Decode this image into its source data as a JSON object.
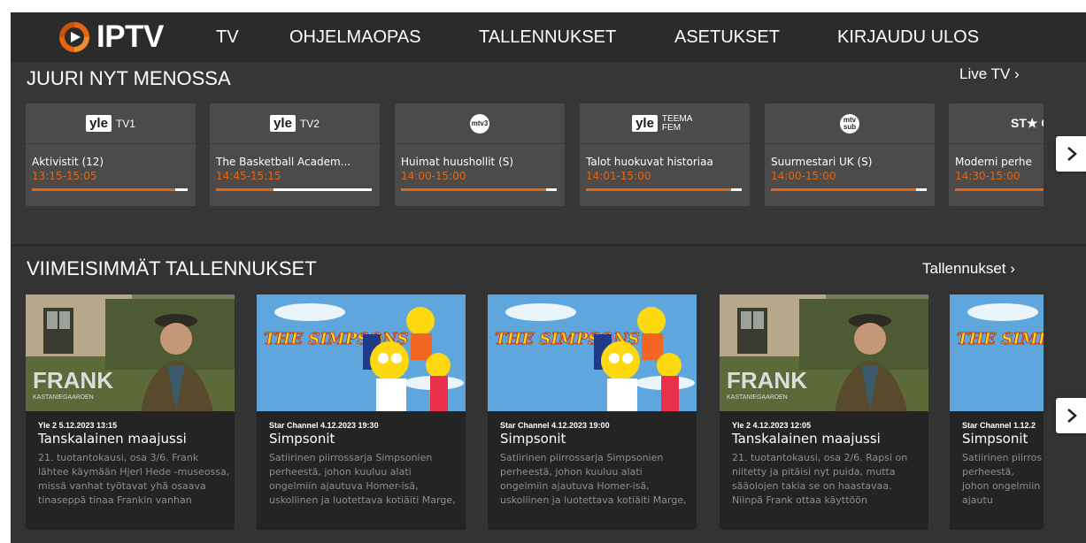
{
  "header": {
    "logo_text": "IPTV",
    "nav": [
      "TV",
      "OHJELMAOPAS",
      "TALLENNUKSET",
      "ASETUKSET",
      "KIRJAUDU ULOS"
    ]
  },
  "now_playing": {
    "title": "JUURI NYT MENOSSA",
    "link": "Live TV ›",
    "channels": [
      {
        "logo": "yle",
        "logo_sub": "TV1",
        "program": "Aktivistit (12)",
        "time": "13:15-15:05",
        "progress": 0.92
      },
      {
        "logo": "yle",
        "logo_sub": "TV2",
        "program": "The Basketball Academ...",
        "time": "14:45-15:15",
        "progress": 0.37
      },
      {
        "logo": "mtv3",
        "logo_sub": "mtv3",
        "program": "Huimat huushollit (S)",
        "time": "14:00-15:00",
        "progress": 0.93
      },
      {
        "logo": "yle",
        "logo_sub": "TEEMA FEM",
        "program": "Talot huokuvat historiaa",
        "time": "14:01-15:00",
        "progress": 0.93
      },
      {
        "logo": "mtv",
        "logo_sub": "mtv sub",
        "program": "Suurmestari UK (S)",
        "time": "14:00-15:00",
        "progress": 0.93
      },
      {
        "logo": "star",
        "logo_sub": "ST★ CHANN",
        "program": "Moderni perhe",
        "time": "14:30-15:00",
        "progress": 0.8
      }
    ]
  },
  "recordings": {
    "title": "VIIMEISIMMÄT TALLENNUKSET",
    "link": "Tallennukset ›",
    "items": [
      {
        "thumb": "frank",
        "meta": "Yle 2 5.12.2023  13:15",
        "title": "Tanskalainen maajussi",
        "desc": "21. tuotantokausi, osa 3/6. Frank lähtee käymään Hjerl Hede -museossa, missä vanhat työtavat yhä osaava tinaseppä tinaa Frankin vanhan"
      },
      {
        "thumb": "simpsons",
        "meta": "Star Channel 4.12.2023  19:30",
        "title": "Simpsonit",
        "desc": "Satiirinen piirrossarja Simpsonien perheestä, johon kuuluu alati ongelmiin ajautuva Homer-isä, uskollinen ja luotettava kotiäiti Marge,"
      },
      {
        "thumb": "simpsons",
        "meta": "Star Channel 4.12.2023  19:00",
        "title": "Simpsonit",
        "desc": "Satiirinen piirrossarja Simpsonien perheestä, johon kuuluu alati ongelmiin ajautuva Homer-isä, uskollinen ja luotettava kotiäiti Marge,"
      },
      {
        "thumb": "frank",
        "meta": "Yle 2 4.12.2023  12:05",
        "title": "Tanskalainen maajussi",
        "desc": "21. tuotantokausi, osa 2/6. Rapsi on niitetty ja pitäisi nyt puida, mutta sääolojen takia se on haastavaa. Niinpä Frank ottaa käyttöön"
      },
      {
        "thumb": "simpsons",
        "meta": "Star Channel 1.12.2",
        "title": "Simpsonit",
        "desc": "Satiirinen piirros perheestä, johon ongelmiin ajautu uskollinen ja luo"
      }
    ],
    "thumb_text": {
      "frank": "FRANK",
      "frank_sub": "KASTANIEGAARDEN",
      "simpsons": "THE SIMPSONS"
    }
  },
  "colors": {
    "accent": "#e8650e",
    "bg": "#363636",
    "topbar": "#2b2b2b"
  },
  "icons": {
    "next": "chevron-right-icon",
    "logo": "iptv-logo-icon"
  }
}
